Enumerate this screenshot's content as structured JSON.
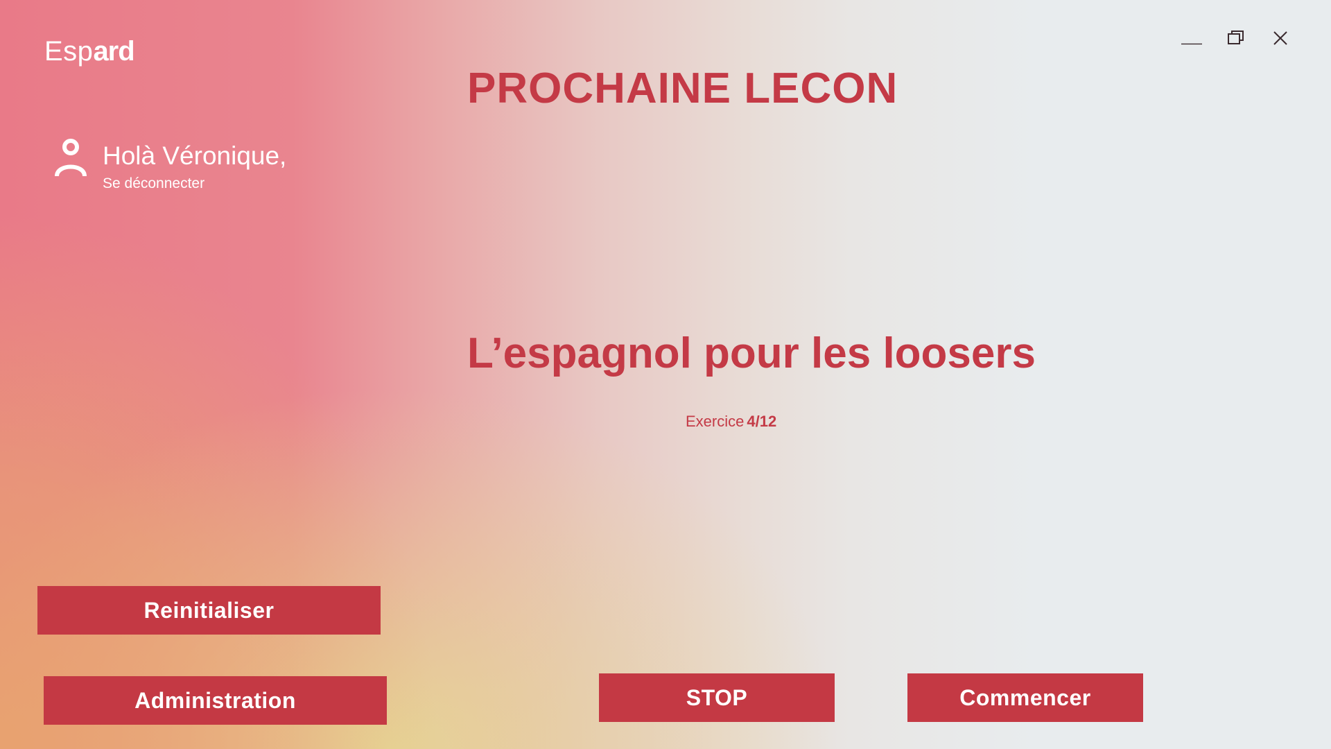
{
  "brand": {
    "part1": "Esp",
    "part2": "ard"
  },
  "window_controls": {
    "minimize_icon": "minimize-icon",
    "restore_icon": "restore-icon",
    "close_icon": "close-icon"
  },
  "user": {
    "icon": "user-icon",
    "greeting": "Holà Véronique,",
    "logout_label": "Se déconnecter"
  },
  "main": {
    "heading": "PROCHAINE LECON",
    "lesson_title": "L’espagnol pour les loosers",
    "exercise_label": "Exercice",
    "exercise_progress": "4/12"
  },
  "buttons": {
    "reset": "Reinitialiser",
    "admin": "Administration",
    "stop": "STOP",
    "start": "Commencer"
  },
  "colors": {
    "accent": "#c43944",
    "text_on_accent": "#ffffff",
    "background_right": "#e8ecee",
    "background_left": "#e97a88"
  }
}
